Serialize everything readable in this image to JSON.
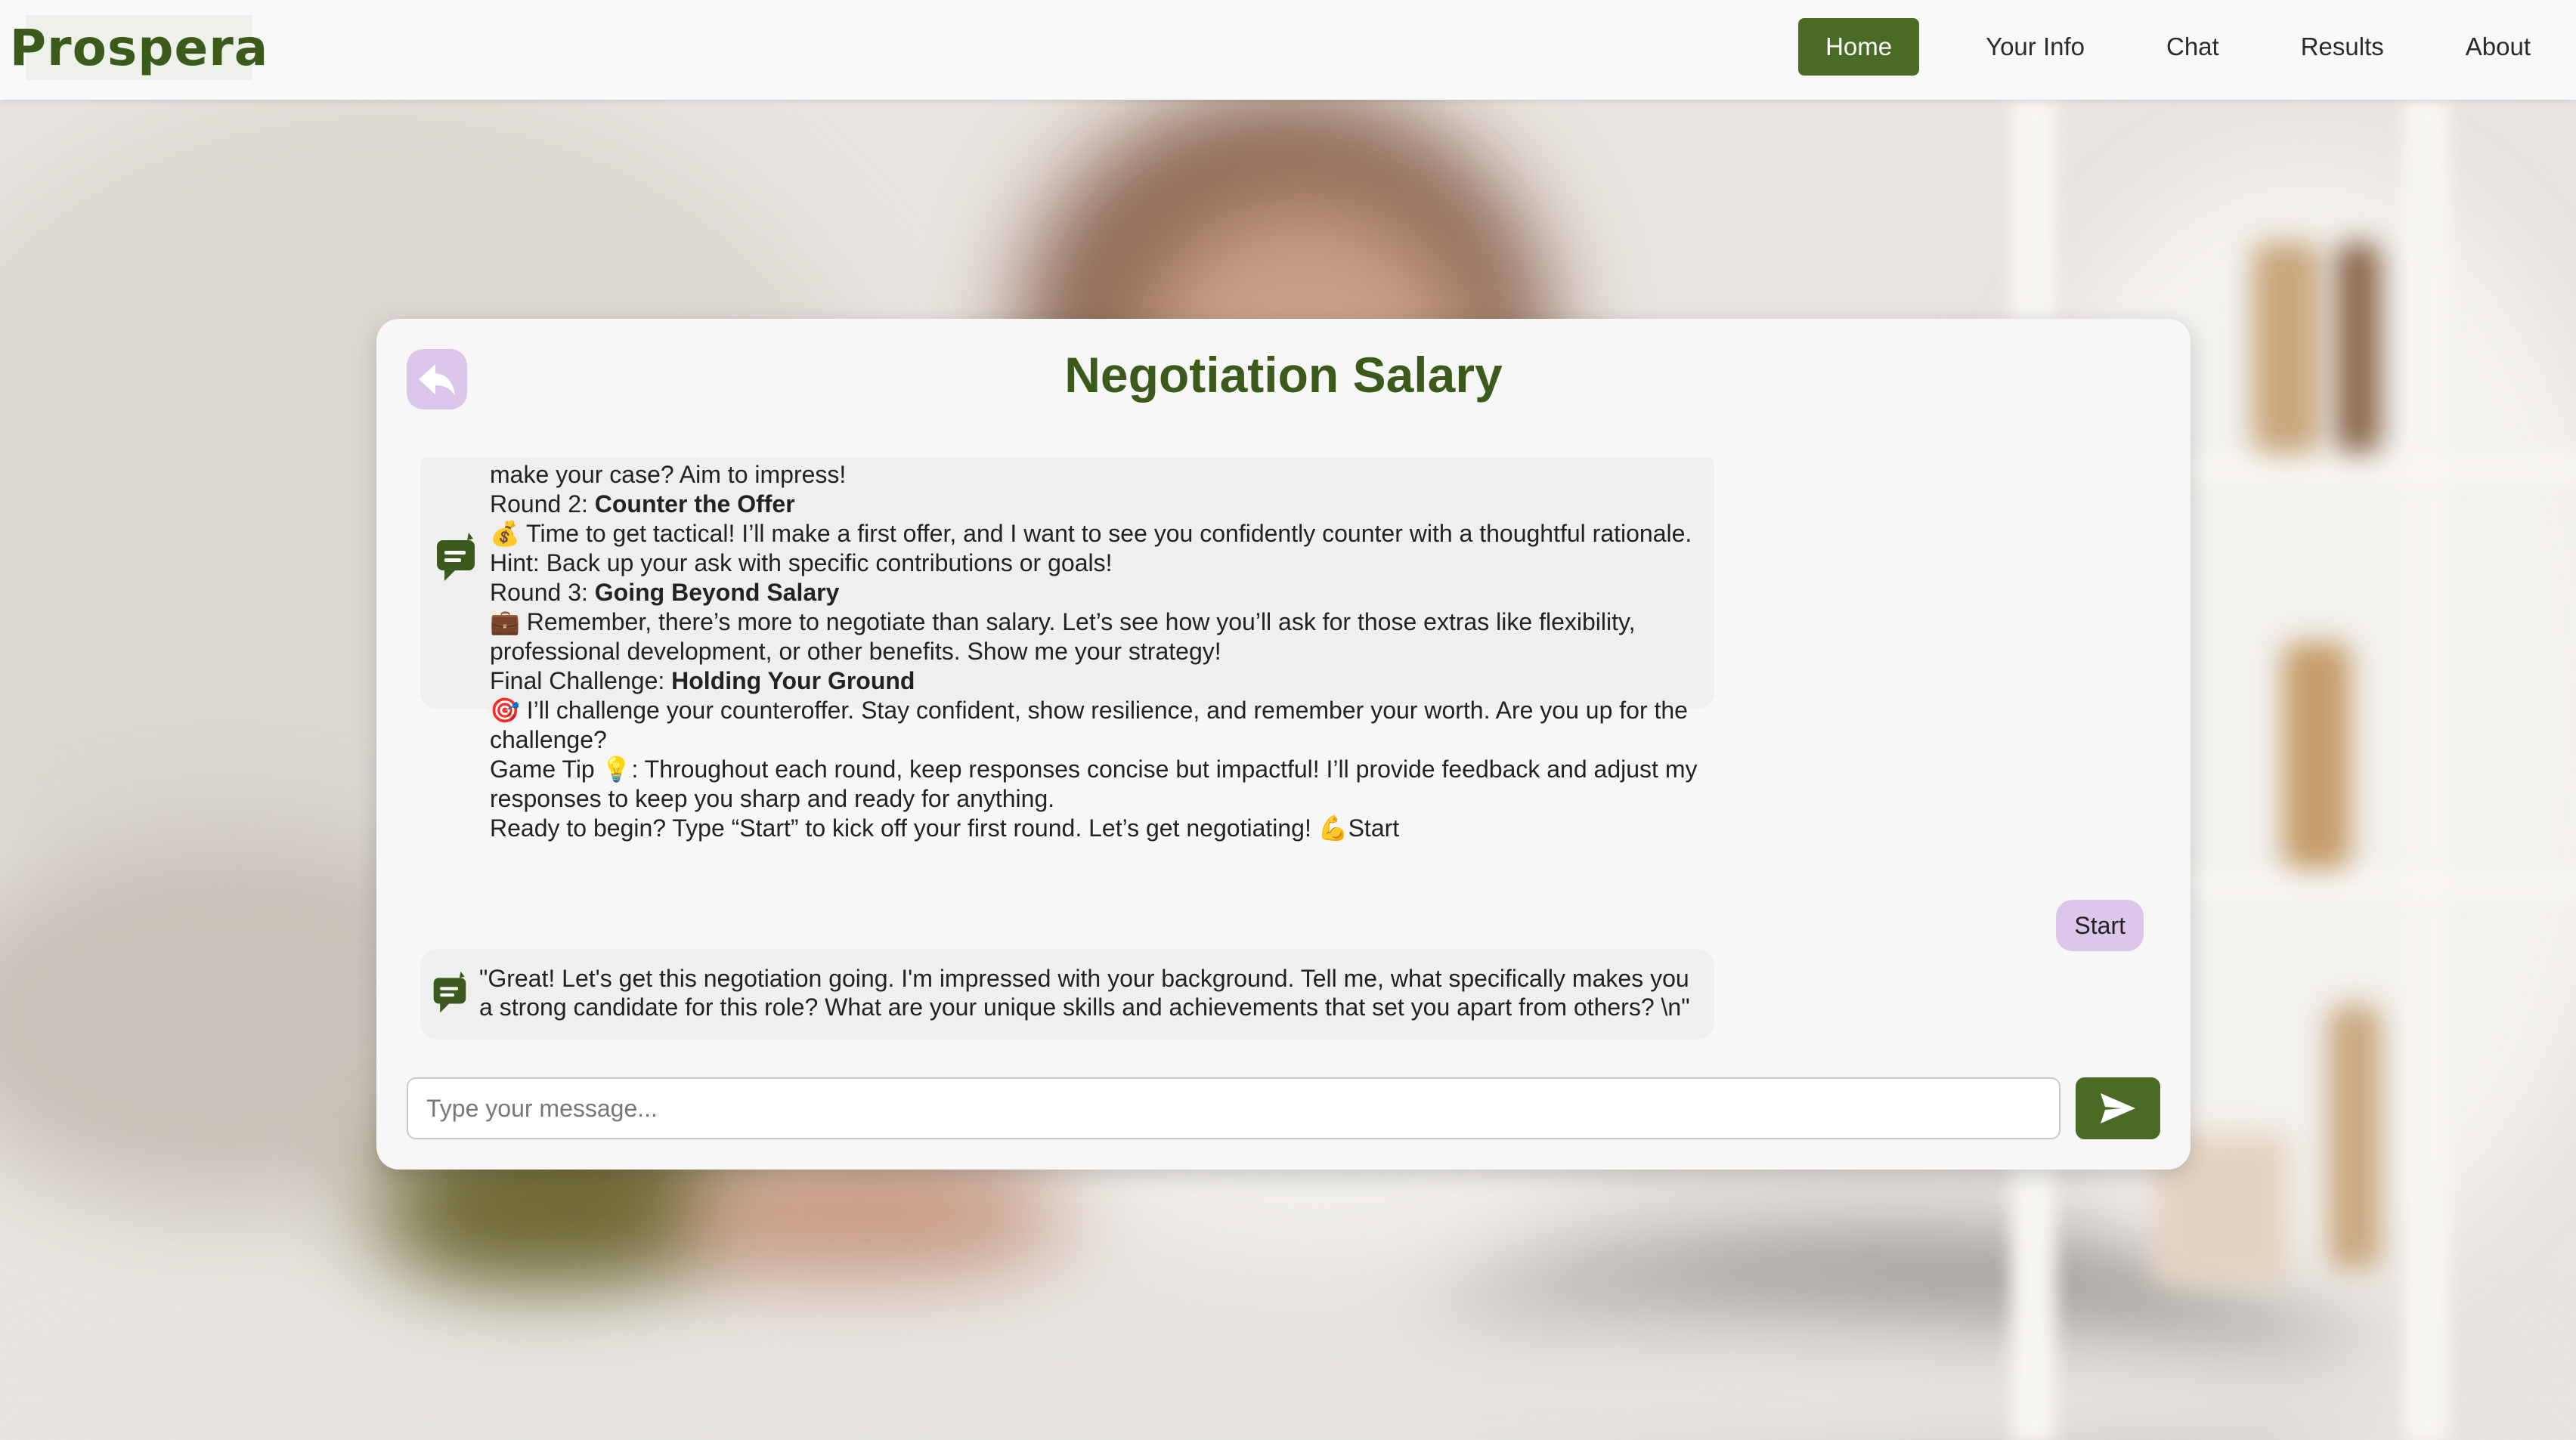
{
  "app": {
    "logo_text": "Prospera"
  },
  "nav": {
    "items": [
      {
        "label": "Home",
        "active": true
      },
      {
        "label": "Your Info"
      },
      {
        "label": "Chat"
      },
      {
        "label": "Results"
      },
      {
        "label": "About"
      }
    ]
  },
  "card": {
    "title": "Negotiation Salary",
    "back_icon": "reply-arrow-icon"
  },
  "messages": {
    "bot_first": {
      "lines": [
        {
          "prefix": "make your case? Aim to impress!",
          "bold": ""
        },
        {
          "prefix": "Round 2: ",
          "bold": "Counter the Offer"
        },
        {
          "prefix": "💰 Time to get tactical! I’ll make a first offer, and I want to see you confidently counter with a thoughtful rationale.",
          "bold": ""
        },
        {
          "prefix": "Hint: Back up your ask with specific contributions or goals!",
          "bold": ""
        },
        {
          "prefix": "Round 3: ",
          "bold": "Going Beyond Salary"
        },
        {
          "prefix": "💼 Remember, there’s more to negotiate than salary. Let’s see how you’ll ask for those extras like flexibility,",
          "bold": ""
        },
        {
          "prefix": "professional development, or other benefits. Show me your strategy!",
          "bold": ""
        },
        {
          "prefix": "Final Challenge: ",
          "bold": "Holding Your Ground"
        },
        {
          "prefix": "🎯 I’ll challenge your counteroffer. Stay confident, show resilience, and remember your worth. Are you up for the",
          "bold": ""
        },
        {
          "prefix": "challenge?",
          "bold": ""
        },
        {
          "prefix": "Game Tip 💡: Throughout each round, keep responses concise but impactful! I’ll provide feedback and adjust my",
          "bold": ""
        },
        {
          "prefix": "responses to keep you sharp and ready for anything.",
          "bold": ""
        },
        {
          "prefix": "Ready to begin? Type “Start” to kick off your first round. Let’s get negotiating! 💪Start",
          "bold": ""
        }
      ]
    },
    "user": {
      "text": "Start"
    },
    "bot_second": {
      "lines": [
        "\"Great! Let's get this negotiation going. I'm impressed with your background. Tell me, what specifically makes you",
        "a strong candidate for this role? What are your unique skills and achievements that set you apart from others? \\n\""
      ]
    },
    "bot_icon": "chat-bubble-icon"
  },
  "input": {
    "placeholder": "Type your message...",
    "value": "",
    "send_icon": "send-arrow-icon"
  },
  "colors": {
    "brand_green": "#3c5a1b",
    "button_green": "#4a6b25",
    "lavender": "#dcc6ea",
    "nav_bg": "#f8f9fb",
    "card_bg": "#f7f7f7",
    "bubble_bg": "#efefef"
  }
}
